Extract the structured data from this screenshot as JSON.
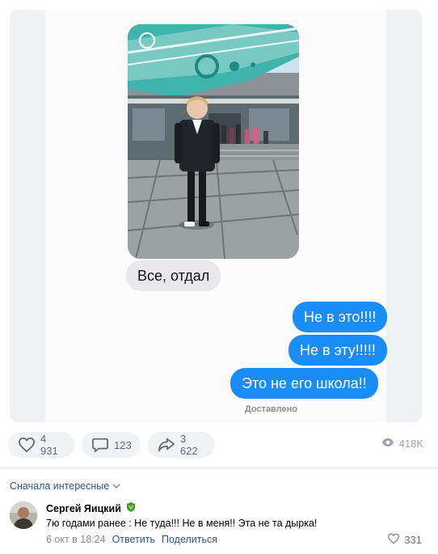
{
  "post": {
    "messages": [
      {
        "direction": "in",
        "text": "Все, отдал"
      },
      {
        "direction": "out",
        "text": "Не в это!!!!"
      },
      {
        "direction": "out",
        "text": "Не в эту!!!!!"
      },
      {
        "direction": "out",
        "text": "Это не его школа!!"
      }
    ],
    "delivered_label": "Доставлено",
    "actions": {
      "likes": "4 931",
      "comments": "123",
      "shares": "3 622",
      "views": "418K"
    }
  },
  "comments": {
    "sort_label": "Сначала интересные",
    "items": [
      {
        "author": "Сергей Яицкий",
        "text": "7ю годами ранее : Не туда!!! Не в меня!! Эта не та дырка!",
        "date": "6 окт в 18:24",
        "reply_label": "Ответить",
        "share_label": "Поделиться",
        "likes": "331"
      }
    ]
  },
  "colors": {
    "bubble_out": "#1a8cf5",
    "bubble_in": "#e9e9eb",
    "link": "#2a5885"
  }
}
